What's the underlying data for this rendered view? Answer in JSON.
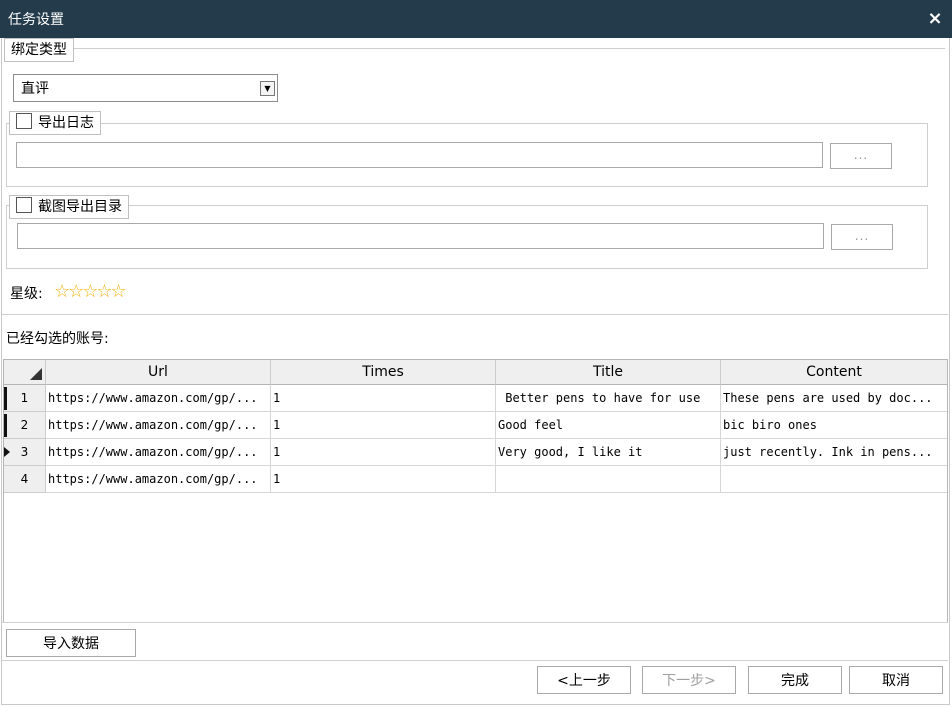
{
  "window": {
    "title": "任务设置",
    "close_label": "×"
  },
  "bind_type": {
    "legend": "绑定类型",
    "combo_value": "直评",
    "arrow_glyph": "▼"
  },
  "export_log": {
    "label": "导出日志",
    "checked": false,
    "path_value": "",
    "browse_label": "..."
  },
  "screenshot_dir": {
    "label": "截图导出目录",
    "checked": false,
    "path_value": "",
    "browse_label": "..."
  },
  "rating": {
    "label": "星级:",
    "stars_glyph": "☆☆☆☆☆",
    "value": 0,
    "max": 5
  },
  "accounts": {
    "label": "已经勾选的账号:",
    "columns": [
      "Url",
      "Times",
      "Title",
      "Content"
    ],
    "rows": [
      {
        "num": "1",
        "url": "https://www.amazon.com/gp/...",
        "times": "1",
        "title": " Better pens to have for use",
        "content": "These pens are used by doc..."
      },
      {
        "num": "2",
        "url": "https://www.amazon.com/gp/...",
        "times": "1",
        "title": "Good feel",
        "content": "bic biro ones"
      },
      {
        "num": "3",
        "url": "https://www.amazon.com/gp/...",
        "times": "1",
        "title": "Very good, I like it",
        "content": "just recently. Ink in pens..."
      },
      {
        "num": "4",
        "url": "https://www.amazon.com/gp/...",
        "times": "1",
        "title": "",
        "content": ""
      }
    ]
  },
  "buttons": {
    "import": "导入数据",
    "prev": "<上一步",
    "next": "下一步>",
    "finish": "完成",
    "cancel": "取消"
  }
}
